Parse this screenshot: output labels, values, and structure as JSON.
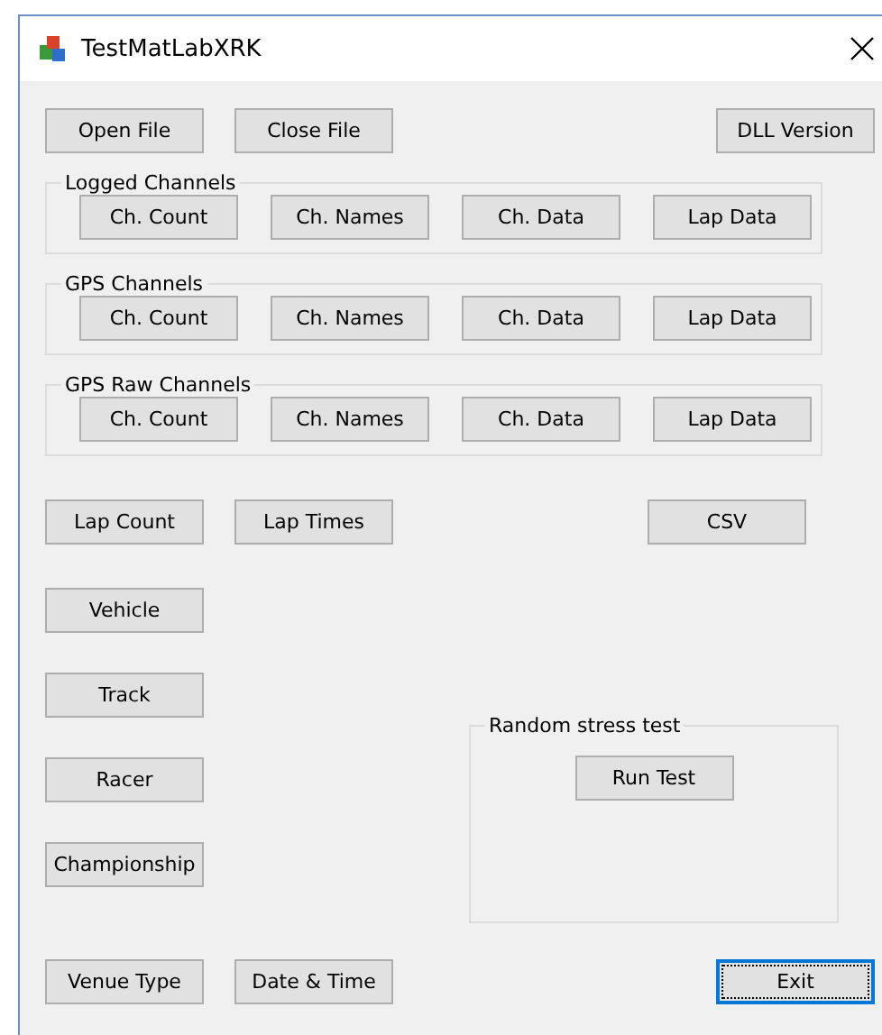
{
  "window": {
    "title": "TestMatLabXRK"
  },
  "file_buttons": [
    "Open File",
    "Close File"
  ],
  "dll_button": "DLL Version",
  "groups": [
    {
      "title": "Logged Channels",
      "buttons": [
        "Ch. Count",
        "Ch. Names",
        "Ch. Data",
        "Lap Data"
      ]
    },
    {
      "title": "GPS Channels",
      "buttons": [
        "Ch. Count",
        "Ch. Names",
        "Ch. Data",
        "Lap Data"
      ]
    },
    {
      "title": "GPS Raw Channels",
      "buttons": [
        "Ch. Count",
        "Ch. Names",
        "Ch. Data",
        "Lap Data"
      ]
    }
  ],
  "lap_buttons": [
    "Lap Count",
    "Lap Times"
  ],
  "csv_button": "CSV",
  "info_buttons": [
    "Vehicle",
    "Track",
    "Racer",
    "Championship"
  ],
  "bottom_buttons": [
    "Venue Type",
    "Date & Time"
  ],
  "stress_test": {
    "title": "Random stress test",
    "button": "Run Test"
  },
  "exit_button": {
    "label": "Exit",
    "focused": true
  }
}
